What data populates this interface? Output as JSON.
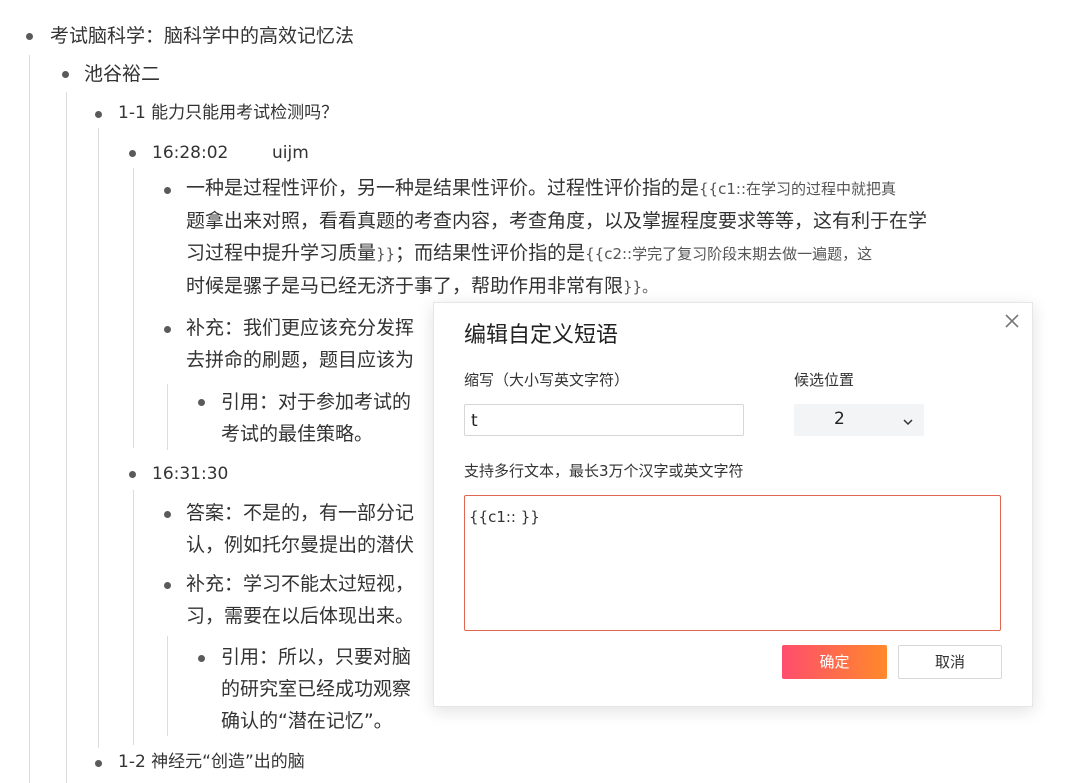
{
  "outline": {
    "l1": "考试脑科学：脑科学中的高效记忆法",
    "l2": "池谷裕二",
    "ch1": "1-1 能力只能用考试检测吗？",
    "time1": "16:28:02",
    "time1_tag": "uijm",
    "p1_line1": "一种是过程性评价，另一种是结果性评价。过程性评价指的是",
    "p1_c1": "{{c1::在学习的过程中就把真",
    "p1_line2": "题拿出来对照，看看真题的考查内容，考查角度，以及掌握程度要求等等，这有利于在学",
    "p1_line3a": "习过程中提升学习质量",
    "p1_line3b": "}}",
    "p1_line3c": "；而结果性评价指的是",
    "p1_c2": "{{c2::学完了复习阶段末期去做一遍题，这",
    "p1_line4": "时候是骡子是马已经无济于事了，帮助作用非常有限",
    "p1_line4b": "}}。",
    "p2_line1": "补充：我们更应该充分发挥",
    "p2_line2": "去拼命的刷题，题目应该为",
    "q1_line1": "引用：对于参加考试的",
    "q1_line2": "考试的最佳策略。",
    "time2": "16:31:30",
    "a1_line1": "答案：不是的，有一部分记",
    "a1_line2": "认，例如托尔曼提出的潜伏",
    "s2_line1": "补充：学习不能太过短视，",
    "s2_line2": "习，需要在以后体现出来。",
    "q2_line1": "引用：所以，只要对脑",
    "q2_line2": "的研究室已经成功观察",
    "q2_line3": "确认的“潜在记忆”。",
    "ch2": "1-2 神经元“创造”出的脑"
  },
  "dialog": {
    "title": "编辑自定义短语",
    "abbr_label": "缩写（大小写英文字符）",
    "abbr_value": "t",
    "pos_label": "候选位置",
    "pos_value": "2",
    "hint": "支持多行文本，最长3万个汉字或英文字符",
    "content": "{{c1:: }}",
    "ok": "确定",
    "cancel": "取消"
  }
}
